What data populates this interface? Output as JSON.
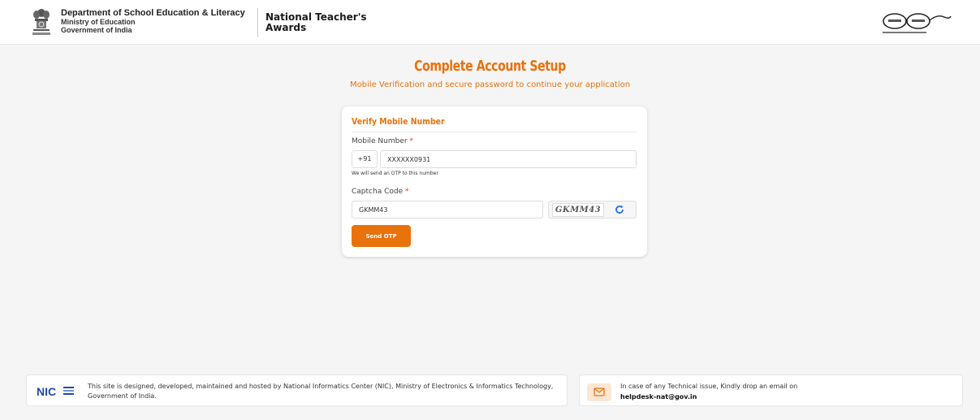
{
  "header": {
    "dept_name": "Department of School Education & Literacy",
    "ministry": "Ministry of Education",
    "government": "Government of India",
    "portal_title_line1": "National Teacher's",
    "portal_title_line2": "Awards"
  },
  "page": {
    "title": "Complete Account Setup",
    "subtitle": "Mobile Verification and secure password to continue your application"
  },
  "form": {
    "section_title": "Verify Mobile Number",
    "mobile_label": "Mobile Number",
    "required_mark": "*",
    "country_code": "+91",
    "mobile_value": "XXXXXX0931",
    "otp_hint": "We will send an OTP to this number",
    "captcha_label": "Captcha Code",
    "captcha_value": "GKMM43",
    "captcha_image_text": "GKMM43",
    "send_otp_label": "Send OTP"
  },
  "footer": {
    "nic_text": "This site is designed, developed, maintained and hosted by National Informatics Center (NIC), Ministry of Electronics & Informatics Technology, Government of India.",
    "help_text": "In case of any Technical issue, Kindly drop an email on",
    "help_email": "helpdesk-nat@gov.in"
  },
  "colors": {
    "accent": "#e8720c",
    "background": "#f5f5f5"
  },
  "icons": [
    "national-emblem-icon",
    "swachh-bharat-logo",
    "refresh-icon",
    "nic-logo",
    "mail-icon"
  ]
}
